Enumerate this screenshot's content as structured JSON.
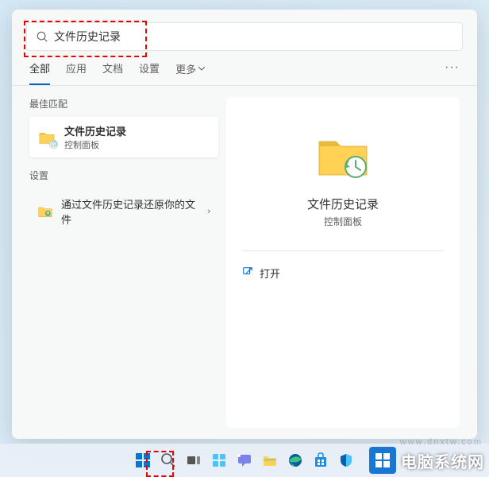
{
  "search": {
    "value": "文件历史记录"
  },
  "tabs": {
    "items": [
      "全部",
      "应用",
      "文档",
      "设置",
      "更多"
    ],
    "active_index": 0
  },
  "left": {
    "best_match_label": "最佳匹配",
    "result": {
      "title": "文件历史记录",
      "subtitle": "控制面板"
    },
    "settings_label": "设置",
    "settings_item": "通过文件历史记录还原你的文件"
  },
  "preview": {
    "title": "文件历史记录",
    "subtitle": "控制面板",
    "open_label": "打开"
  },
  "watermark": {
    "text": "电脑系统网",
    "url": "www.dnxtw.com"
  }
}
